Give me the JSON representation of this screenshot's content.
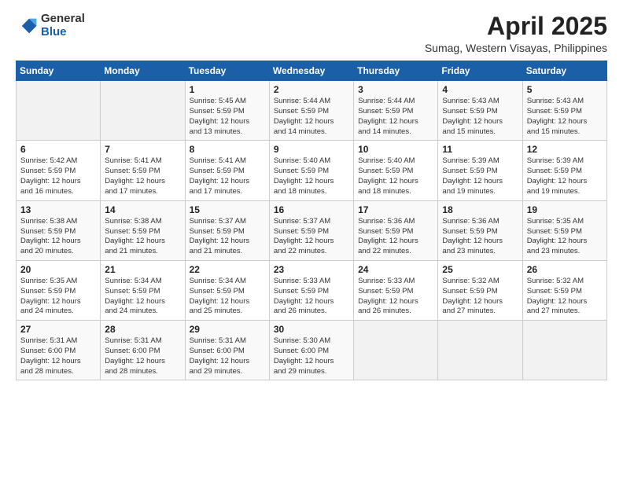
{
  "header": {
    "logo_general": "General",
    "logo_blue": "Blue",
    "month_title": "April 2025",
    "location": "Sumag, Western Visayas, Philippines"
  },
  "weekdays": [
    "Sunday",
    "Monday",
    "Tuesday",
    "Wednesday",
    "Thursday",
    "Friday",
    "Saturday"
  ],
  "weeks": [
    [
      {
        "day": "",
        "info": ""
      },
      {
        "day": "",
        "info": ""
      },
      {
        "day": "1",
        "info": "Sunrise: 5:45 AM\nSunset: 5:59 PM\nDaylight: 12 hours\nand 13 minutes."
      },
      {
        "day": "2",
        "info": "Sunrise: 5:44 AM\nSunset: 5:59 PM\nDaylight: 12 hours\nand 14 minutes."
      },
      {
        "day": "3",
        "info": "Sunrise: 5:44 AM\nSunset: 5:59 PM\nDaylight: 12 hours\nand 14 minutes."
      },
      {
        "day": "4",
        "info": "Sunrise: 5:43 AM\nSunset: 5:59 PM\nDaylight: 12 hours\nand 15 minutes."
      },
      {
        "day": "5",
        "info": "Sunrise: 5:43 AM\nSunset: 5:59 PM\nDaylight: 12 hours\nand 15 minutes."
      }
    ],
    [
      {
        "day": "6",
        "info": "Sunrise: 5:42 AM\nSunset: 5:59 PM\nDaylight: 12 hours\nand 16 minutes."
      },
      {
        "day": "7",
        "info": "Sunrise: 5:41 AM\nSunset: 5:59 PM\nDaylight: 12 hours\nand 17 minutes."
      },
      {
        "day": "8",
        "info": "Sunrise: 5:41 AM\nSunset: 5:59 PM\nDaylight: 12 hours\nand 17 minutes."
      },
      {
        "day": "9",
        "info": "Sunrise: 5:40 AM\nSunset: 5:59 PM\nDaylight: 12 hours\nand 18 minutes."
      },
      {
        "day": "10",
        "info": "Sunrise: 5:40 AM\nSunset: 5:59 PM\nDaylight: 12 hours\nand 18 minutes."
      },
      {
        "day": "11",
        "info": "Sunrise: 5:39 AM\nSunset: 5:59 PM\nDaylight: 12 hours\nand 19 minutes."
      },
      {
        "day": "12",
        "info": "Sunrise: 5:39 AM\nSunset: 5:59 PM\nDaylight: 12 hours\nand 19 minutes."
      }
    ],
    [
      {
        "day": "13",
        "info": "Sunrise: 5:38 AM\nSunset: 5:59 PM\nDaylight: 12 hours\nand 20 minutes."
      },
      {
        "day": "14",
        "info": "Sunrise: 5:38 AM\nSunset: 5:59 PM\nDaylight: 12 hours\nand 21 minutes."
      },
      {
        "day": "15",
        "info": "Sunrise: 5:37 AM\nSunset: 5:59 PM\nDaylight: 12 hours\nand 21 minutes."
      },
      {
        "day": "16",
        "info": "Sunrise: 5:37 AM\nSunset: 5:59 PM\nDaylight: 12 hours\nand 22 minutes."
      },
      {
        "day": "17",
        "info": "Sunrise: 5:36 AM\nSunset: 5:59 PM\nDaylight: 12 hours\nand 22 minutes."
      },
      {
        "day": "18",
        "info": "Sunrise: 5:36 AM\nSunset: 5:59 PM\nDaylight: 12 hours\nand 23 minutes."
      },
      {
        "day": "19",
        "info": "Sunrise: 5:35 AM\nSunset: 5:59 PM\nDaylight: 12 hours\nand 23 minutes."
      }
    ],
    [
      {
        "day": "20",
        "info": "Sunrise: 5:35 AM\nSunset: 5:59 PM\nDaylight: 12 hours\nand 24 minutes."
      },
      {
        "day": "21",
        "info": "Sunrise: 5:34 AM\nSunset: 5:59 PM\nDaylight: 12 hours\nand 24 minutes."
      },
      {
        "day": "22",
        "info": "Sunrise: 5:34 AM\nSunset: 5:59 PM\nDaylight: 12 hours\nand 25 minutes."
      },
      {
        "day": "23",
        "info": "Sunrise: 5:33 AM\nSunset: 5:59 PM\nDaylight: 12 hours\nand 26 minutes."
      },
      {
        "day": "24",
        "info": "Sunrise: 5:33 AM\nSunset: 5:59 PM\nDaylight: 12 hours\nand 26 minutes."
      },
      {
        "day": "25",
        "info": "Sunrise: 5:32 AM\nSunset: 5:59 PM\nDaylight: 12 hours\nand 27 minutes."
      },
      {
        "day": "26",
        "info": "Sunrise: 5:32 AM\nSunset: 5:59 PM\nDaylight: 12 hours\nand 27 minutes."
      }
    ],
    [
      {
        "day": "27",
        "info": "Sunrise: 5:31 AM\nSunset: 6:00 PM\nDaylight: 12 hours\nand 28 minutes."
      },
      {
        "day": "28",
        "info": "Sunrise: 5:31 AM\nSunset: 6:00 PM\nDaylight: 12 hours\nand 28 minutes."
      },
      {
        "day": "29",
        "info": "Sunrise: 5:31 AM\nSunset: 6:00 PM\nDaylight: 12 hours\nand 29 minutes."
      },
      {
        "day": "30",
        "info": "Sunrise: 5:30 AM\nSunset: 6:00 PM\nDaylight: 12 hours\nand 29 minutes."
      },
      {
        "day": "",
        "info": ""
      },
      {
        "day": "",
        "info": ""
      },
      {
        "day": "",
        "info": ""
      }
    ]
  ]
}
